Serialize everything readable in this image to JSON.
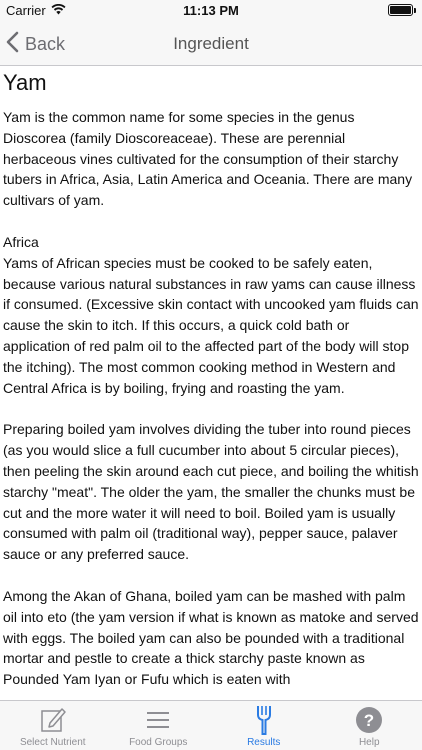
{
  "status_bar": {
    "carrier": "Carrier",
    "time": "11:13 PM",
    "battery_level": 1.0
  },
  "nav": {
    "back_label": "Back",
    "title": "Ingredient"
  },
  "article": {
    "title": "Yam",
    "intro": "Yam is the common name for some species in the genus Dioscorea (family Dioscoreaceae). These are perennial herbaceous vines cultivated for the consumption of their starchy tubers in Africa, Asia, Latin America and Oceania. There are many cultivars of yam.",
    "section_heading": "Africa",
    "section_para_1": "Yams of African species must be cooked to be safely eaten, because various natural substances in raw yams can cause illness if consumed. (Excessive skin contact with uncooked yam fluids can cause the skin to itch. If this occurs, a quick cold bath or application of red palm oil to the affected part of the body will stop the itching). The most common cooking method in Western and Central Africa is by boiling, frying and roasting the yam.",
    "section_para_2": "Preparing boiled yam involves dividing the tuber into round pieces (as you would slice a full cucumber into about 5 circular pieces), then peeling the skin around each cut piece, and boiling the whitish starchy \"meat\". The older the yam, the smaller the chunks must be cut and the more water it will need to boil. Boiled yam is usually consumed with palm oil (traditional way), pepper sauce, palaver sauce or any preferred sauce.",
    "section_para_3": "Among the Akan of Ghana, boiled yam can be mashed with palm oil into eto (the yam version if what is known as matoke and served with eggs. The boiled yam can also be pounded with a traditional mortar and pestle to create a thick starchy paste known as Pounded Yam Iyan or Fufu which is eaten with"
  },
  "tabs": [
    {
      "label": "Select Nutrient",
      "icon": "edit-icon",
      "active": false
    },
    {
      "label": "Food Groups",
      "icon": "list-icon",
      "active": false
    },
    {
      "label": "Results",
      "icon": "fork-icon",
      "active": true
    },
    {
      "label": "Help",
      "icon": "help-icon",
      "active": false
    }
  ],
  "colors": {
    "accent": "#2a7be3",
    "inactive": "#8e8e93",
    "bar_background": "#f7f7f7"
  }
}
